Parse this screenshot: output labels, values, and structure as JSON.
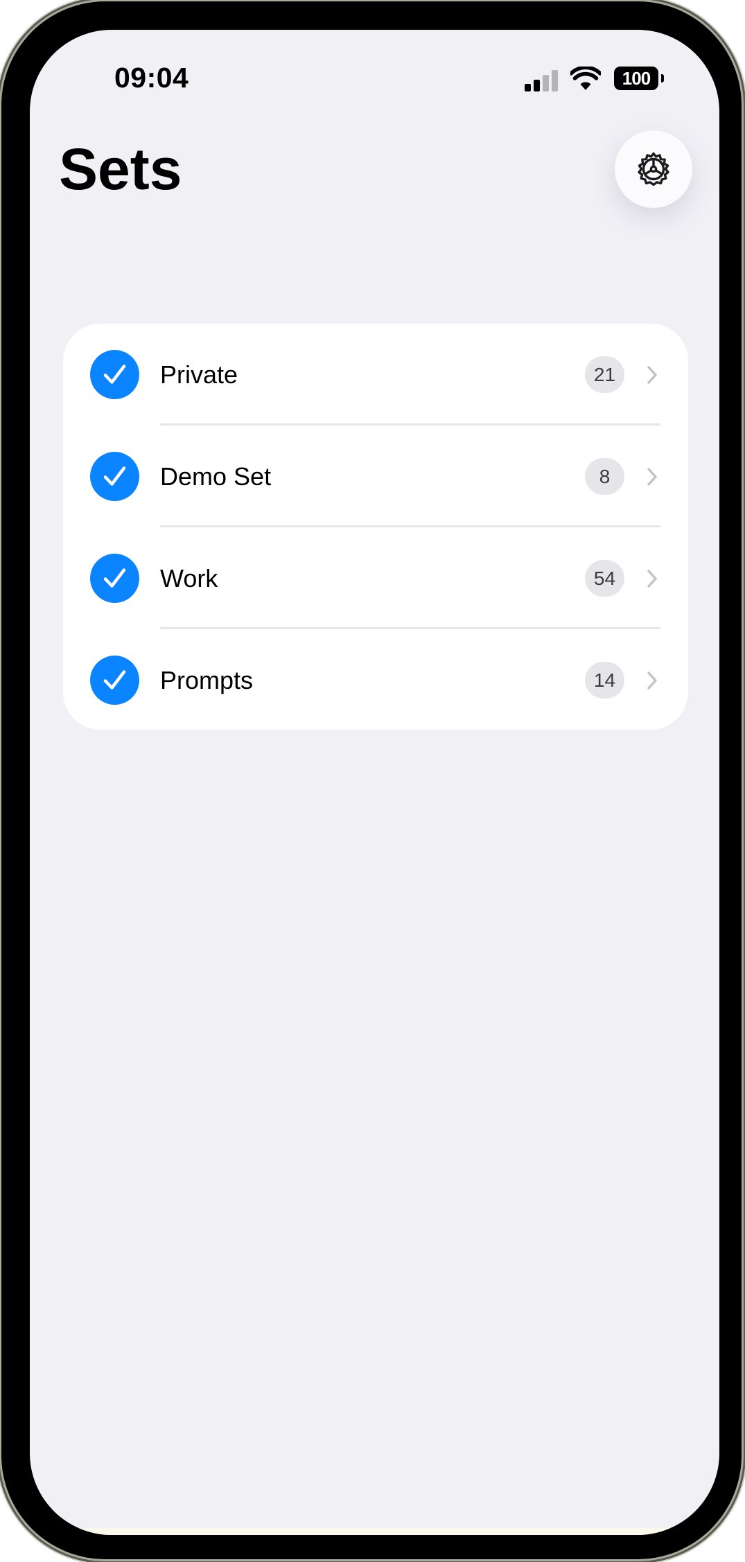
{
  "status_bar": {
    "time": "09:04",
    "battery": "100",
    "signal_icon": "cellular-signal-icon",
    "wifi_icon": "wifi-icon"
  },
  "header": {
    "title": "Sets",
    "settings_icon": "gear-icon"
  },
  "sets": [
    {
      "label": "Private",
      "count": "21",
      "selected": true
    },
    {
      "label": "Demo Set",
      "count": "8",
      "selected": true
    },
    {
      "label": "Work",
      "count": "54",
      "selected": true
    },
    {
      "label": "Prompts",
      "count": "14",
      "selected": true
    }
  ],
  "colors": {
    "accent": "#0b84ff",
    "background": "#f0f0f5",
    "card": "#ffffff",
    "badge": "#e5e5ea"
  }
}
